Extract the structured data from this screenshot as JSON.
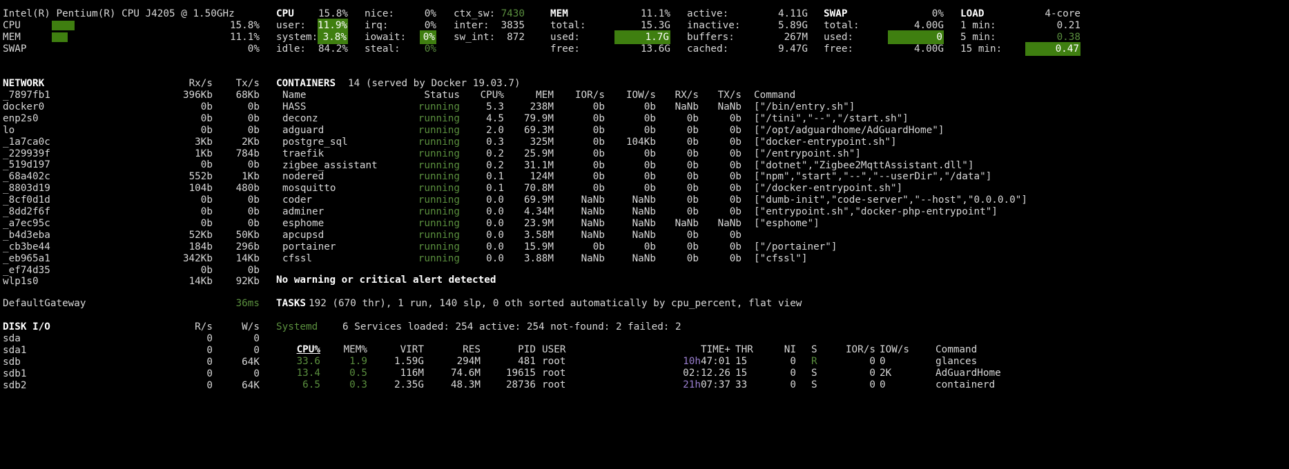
{
  "cpu_name": "Intel(R) Pentium(R) CPU J4205 @ 1.50GHz",
  "quick": {
    "cpu_label": "CPU",
    "cpu_value": "15.8%",
    "cpu_fraction": 0.158,
    "mem_label": "MEM",
    "mem_value": "11.1%",
    "mem_fraction": 0.111,
    "swap_label": "SWAP",
    "swap_value": "0%"
  },
  "cpu_panel": {
    "title": "CPU",
    "total": "15.8%",
    "user_label": "user:",
    "user": "11.9%",
    "system_label": "system:",
    "system": "3.8%",
    "idle_label": "idle:",
    "idle": "84.2%",
    "nice_label": "nice:",
    "nice": "0%",
    "irq_label": "irq:",
    "irq": "0%",
    "iowait_label": "iowait:",
    "iowait": "0%",
    "steal_label": "steal:",
    "steal": "0%",
    "ctx_sw_label": "ctx_sw:",
    "ctx_sw": "7430",
    "inter_label": "inter:",
    "inter": "3835",
    "sw_int_label": "sw_int:",
    "sw_int": "872"
  },
  "mem_panel": {
    "title": "MEM",
    "percent": "11.1%",
    "total_label": "total:",
    "total": "15.3G",
    "used_label": "used:",
    "used": "1.7G",
    "free_label": "free:",
    "free": "13.6G",
    "active_label": "active:",
    "active": "4.11G",
    "inactive_label": "inactive:",
    "inactive": "5.89G",
    "buffers_label": "buffers:",
    "buffers": "267M",
    "cached_label": "cached:",
    "cached": "9.47G"
  },
  "swap_panel": {
    "title": "SWAP",
    "percent": "0%",
    "total_label": "total:",
    "total": "4.00G",
    "used_label": "used:",
    "used": "0",
    "free_label": "free:",
    "free": "4.00G"
  },
  "load_panel": {
    "title": "LOAD",
    "cores": "4-core",
    "m1_label": "1 min:",
    "m1": "0.21",
    "m5_label": "5 min:",
    "m5": "0.38",
    "m15_label": "15 min:",
    "m15": "0.47"
  },
  "network": {
    "title": "NETWORK",
    "rx_header": "Rx/s",
    "tx_header": "Tx/s",
    "rows": [
      {
        "name": "_7897fb1",
        "rx": "396Kb",
        "tx": "68Kb"
      },
      {
        "name": "docker0",
        "rx": "0b",
        "tx": "0b"
      },
      {
        "name": "enp2s0",
        "rx": "0b",
        "tx": "0b"
      },
      {
        "name": "lo",
        "rx": "0b",
        "tx": "0b"
      },
      {
        "name": "_1a7ca0c",
        "rx": "3Kb",
        "tx": "2Kb"
      },
      {
        "name": "_229939f",
        "rx": "1Kb",
        "tx": "784b"
      },
      {
        "name": "_519d197",
        "rx": "0b",
        "tx": "0b"
      },
      {
        "name": "_68a402c",
        "rx": "552b",
        "tx": "1Kb"
      },
      {
        "name": "_8803d19",
        "rx": "104b",
        "tx": "480b"
      },
      {
        "name": "_8cf0d1d",
        "rx": "0b",
        "tx": "0b"
      },
      {
        "name": "_8dd2f6f",
        "rx": "0b",
        "tx": "0b"
      },
      {
        "name": "_a7ec95c",
        "rx": "0b",
        "tx": "0b"
      },
      {
        "name": "_b4d3eba",
        "rx": "52Kb",
        "tx": "50Kb"
      },
      {
        "name": "_cb3be44",
        "rx": "184b",
        "tx": "296b"
      },
      {
        "name": "_eb965a1",
        "rx": "342Kb",
        "tx": "14Kb"
      },
      {
        "name": "_ef74d35",
        "rx": "0b",
        "tx": "0b"
      },
      {
        "name": "wlp1s0",
        "rx": "14Kb",
        "tx": "92Kb"
      }
    ]
  },
  "gateway": {
    "label": "DefaultGateway",
    "value": "36ms"
  },
  "diskio": {
    "title": "DISK I/O",
    "r_header": "R/s",
    "w_header": "W/s",
    "rows": [
      {
        "name": "sda",
        "r": "0",
        "w": "0"
      },
      {
        "name": "sda1",
        "r": "0",
        "w": "0"
      },
      {
        "name": "sdb",
        "r": "0",
        "w": "64K"
      },
      {
        "name": "sdb1",
        "r": "0",
        "w": "0"
      },
      {
        "name": "sdb2",
        "r": "0",
        "w": "64K"
      }
    ]
  },
  "containers": {
    "title": "CONTAINERS",
    "subtitle": "14 (served by Docker 19.03.7)",
    "headers": {
      "name": "Name",
      "status": "Status",
      "cpu": "CPU%",
      "mem": "MEM",
      "ior": "IOR/s",
      "iow": "IOW/s",
      "rx": "RX/s",
      "tx": "TX/s",
      "cmd": "Command"
    },
    "rows": [
      {
        "name": "HASS",
        "status": "running",
        "cpu": "5.3",
        "mem": "238M",
        "ior": "0b",
        "iow": "0b",
        "rx": "NaNb",
        "tx": "NaNb",
        "cmd": "[\"/bin/entry.sh\"]"
      },
      {
        "name": "deconz",
        "status": "running",
        "cpu": "4.5",
        "mem": "79.9M",
        "ior": "0b",
        "iow": "0b",
        "rx": "0b",
        "tx": "0b",
        "cmd": "[\"/tini\",\"--\",\"/start.sh\"]"
      },
      {
        "name": "adguard",
        "status": "running",
        "cpu": "2.0",
        "mem": "69.3M",
        "ior": "0b",
        "iow": "0b",
        "rx": "0b",
        "tx": "0b",
        "cmd": "[\"/opt/adguardhome/AdGuardHome\"]"
      },
      {
        "name": "postgre_sql",
        "status": "running",
        "cpu": "0.3",
        "mem": "325M",
        "ior": "0b",
        "iow": "104Kb",
        "rx": "0b",
        "tx": "0b",
        "cmd": "[\"docker-entrypoint.sh\"]"
      },
      {
        "name": "traefik",
        "status": "running",
        "cpu": "0.2",
        "mem": "25.9M",
        "ior": "0b",
        "iow": "0b",
        "rx": "0b",
        "tx": "0b",
        "cmd": "[\"/entrypoint.sh\"]"
      },
      {
        "name": "zigbee_assistant",
        "status": "running",
        "cpu": "0.2",
        "mem": "31.1M",
        "ior": "0b",
        "iow": "0b",
        "rx": "0b",
        "tx": "0b",
        "cmd": "[\"dotnet\",\"Zigbee2MqttAssistant.dll\"]"
      },
      {
        "name": "nodered",
        "status": "running",
        "cpu": "0.1",
        "mem": "124M",
        "ior": "0b",
        "iow": "0b",
        "rx": "0b",
        "tx": "0b",
        "cmd": "[\"npm\",\"start\",\"--\",\"--userDir\",\"/data\"]"
      },
      {
        "name": "mosquitto",
        "status": "running",
        "cpu": "0.1",
        "mem": "70.8M",
        "ior": "0b",
        "iow": "0b",
        "rx": "0b",
        "tx": "0b",
        "cmd": "[\"/docker-entrypoint.sh\"]"
      },
      {
        "name": "coder",
        "status": "running",
        "cpu": "0.0",
        "mem": "69.9M",
        "ior": "NaNb",
        "iow": "NaNb",
        "rx": "0b",
        "tx": "0b",
        "cmd": "[\"dumb-init\",\"code-server\",\"--host\",\"0.0.0.0\"]"
      },
      {
        "name": "adminer",
        "status": "running",
        "cpu": "0.0",
        "mem": "4.34M",
        "ior": "NaNb",
        "iow": "NaNb",
        "rx": "0b",
        "tx": "0b",
        "cmd": "[\"entrypoint.sh\",\"docker-php-entrypoint\"]"
      },
      {
        "name": "esphome",
        "status": "running",
        "cpu": "0.0",
        "mem": "23.9M",
        "ior": "NaNb",
        "iow": "NaNb",
        "rx": "NaNb",
        "tx": "NaNb",
        "cmd": "[\"esphome\"]"
      },
      {
        "name": "apcupsd",
        "status": "running",
        "cpu": "0.0",
        "mem": "3.58M",
        "ior": "NaNb",
        "iow": "NaNb",
        "rx": "0b",
        "tx": "0b",
        "cmd": ""
      },
      {
        "name": "portainer",
        "status": "running",
        "cpu": "0.0",
        "mem": "15.9M",
        "ior": "0b",
        "iow": "0b",
        "rx": "0b",
        "tx": "0b",
        "cmd": "[\"/portainer\"]"
      },
      {
        "name": "cfssl",
        "status": "running",
        "cpu": "0.0",
        "mem": "3.88M",
        "ior": "NaNb",
        "iow": "NaNb",
        "rx": "0b",
        "tx": "0b",
        "cmd": "[\"cfssl\"]"
      }
    ]
  },
  "alert": "No warning or critical alert detected",
  "tasks": {
    "title": "TASKS",
    "text": "192 (670 thr), 1 run, 140 slp, 0 oth sorted automatically by cpu_percent, flat view"
  },
  "systemd": {
    "label": "Systemd",
    "text": "6 Services loaded: 254 active: 254 not-found: 2 failed: 2"
  },
  "processes": {
    "headers": {
      "cpu": "CPU%",
      "mem": "MEM%",
      "virt": "VIRT",
      "res": "RES",
      "pid": "PID",
      "user": "USER",
      "time": "TIME+",
      "thr": "THR",
      "ni": "NI",
      "s": "S",
      "ior": "IOR/s",
      "iow": "IOW/s",
      "cmd": "Command"
    },
    "rows": [
      {
        "cpu": "33.6",
        "mem": "1.9",
        "virt": "1.59G",
        "res": "294M",
        "pid": "481",
        "user": "root",
        "time_h": "10h",
        "time_m": "47:01",
        "thr": "15",
        "ni": "0",
        "s": "R",
        "ior": "0",
        "iow": "0",
        "cmd": "glances"
      },
      {
        "cpu": "13.4",
        "mem": "0.5",
        "virt": "116M",
        "res": "74.6M",
        "pid": "19615",
        "user": "root",
        "time_h": "",
        "time_m": "02:12.26",
        "thr": "15",
        "ni": "0",
        "s": "S",
        "ior": "0",
        "iow": "2K",
        "cmd": "AdGuardHome"
      },
      {
        "cpu": "6.5",
        "mem": "0.3",
        "virt": "2.35G",
        "res": "48.3M",
        "pid": "28736",
        "user": "root",
        "time_h": "21h",
        "time_m": "07:37",
        "thr": "33",
        "ni": "0",
        "s": "S",
        "ior": "0",
        "iow": "0",
        "cmd": "containerd"
      }
    ]
  }
}
